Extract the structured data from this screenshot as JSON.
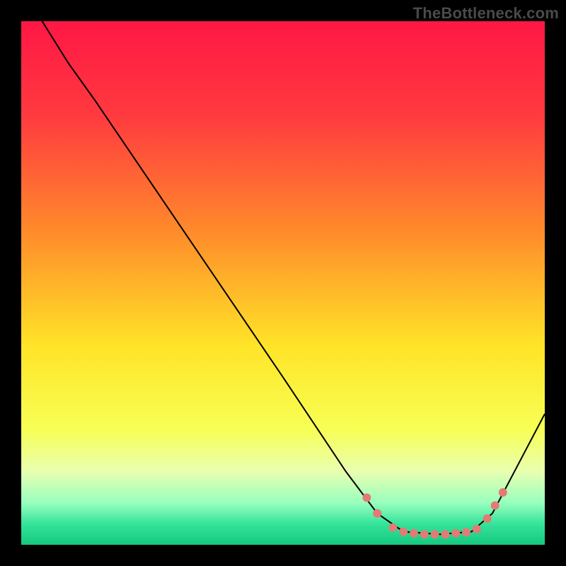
{
  "watermark": "TheBottleneck.com",
  "chart_data": {
    "type": "line",
    "title": "",
    "xlabel": "",
    "ylabel": "",
    "xlim": [
      0,
      100
    ],
    "ylim": [
      0,
      100
    ],
    "background_gradient_stops": [
      {
        "offset": 0,
        "color": "#ff1745"
      },
      {
        "offset": 0.18,
        "color": "#ff3a3f"
      },
      {
        "offset": 0.4,
        "color": "#ff8a2b"
      },
      {
        "offset": 0.62,
        "color": "#ffe427"
      },
      {
        "offset": 0.78,
        "color": "#f7ff55"
      },
      {
        "offset": 0.86,
        "color": "#e8ffb0"
      },
      {
        "offset": 0.92,
        "color": "#98ffbf"
      },
      {
        "offset": 0.96,
        "color": "#35e39a"
      },
      {
        "offset": 1.0,
        "color": "#15c97f"
      }
    ],
    "series": [
      {
        "name": "curve",
        "stroke": "#000000",
        "points": [
          {
            "x": 4,
            "y": 100
          },
          {
            "x": 9,
            "y": 92
          },
          {
            "x": 14,
            "y": 85
          },
          {
            "x": 50,
            "y": 32
          },
          {
            "x": 62,
            "y": 14
          },
          {
            "x": 68,
            "y": 6
          },
          {
            "x": 73,
            "y": 2.5
          },
          {
            "x": 80,
            "y": 2
          },
          {
            "x": 86,
            "y": 2.5
          },
          {
            "x": 90,
            "y": 6
          },
          {
            "x": 100,
            "y": 25
          }
        ]
      }
    ],
    "markers": {
      "color": "#e37b74",
      "radius": 6,
      "points": [
        {
          "x": 66,
          "y": 9
        },
        {
          "x": 68,
          "y": 6
        },
        {
          "x": 71,
          "y": 3.3
        },
        {
          "x": 73,
          "y": 2.5
        },
        {
          "x": 75,
          "y": 2.2
        },
        {
          "x": 77,
          "y": 2.0
        },
        {
          "x": 79,
          "y": 2.0
        },
        {
          "x": 81,
          "y": 2.0
        },
        {
          "x": 83,
          "y": 2.2
        },
        {
          "x": 85,
          "y": 2.4
        },
        {
          "x": 87,
          "y": 3.0
        },
        {
          "x": 89,
          "y": 5.0
        },
        {
          "x": 90.5,
          "y": 7.5
        },
        {
          "x": 92,
          "y": 10
        }
      ]
    }
  }
}
